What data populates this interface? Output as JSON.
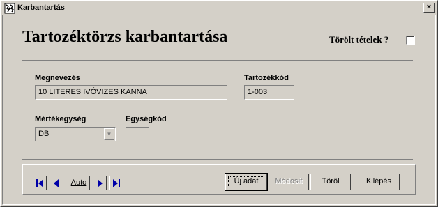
{
  "window": {
    "title": "Karbantartás",
    "close_glyph": "×",
    "icon": "app-icon"
  },
  "form": {
    "heading": "Tartozéktörzs karbantartása",
    "deleted_items_label": "Törölt tételek ?",
    "deleted_items_checked": false
  },
  "fields": {
    "name_label": "Megnevezés",
    "name_value": "10 LITERES IVÓVIZES KANNA",
    "code_label": "Tartozékkód",
    "code_value": "1-003",
    "unit_label": "Mértékegység",
    "unit_value": "DB",
    "unit_code_label": "Egységkód",
    "unit_code_value": ""
  },
  "toolbar": {
    "first_icon": "first-record-icon",
    "prev_icon": "previous-record-icon",
    "auto_label": "Auto",
    "next_icon": "next-record-icon",
    "last_icon": "last-record-icon",
    "new_label": "Új adat",
    "modify_label": "Módosít",
    "delete_label": "Töröl",
    "exit_label": "Kilépés"
  }
}
